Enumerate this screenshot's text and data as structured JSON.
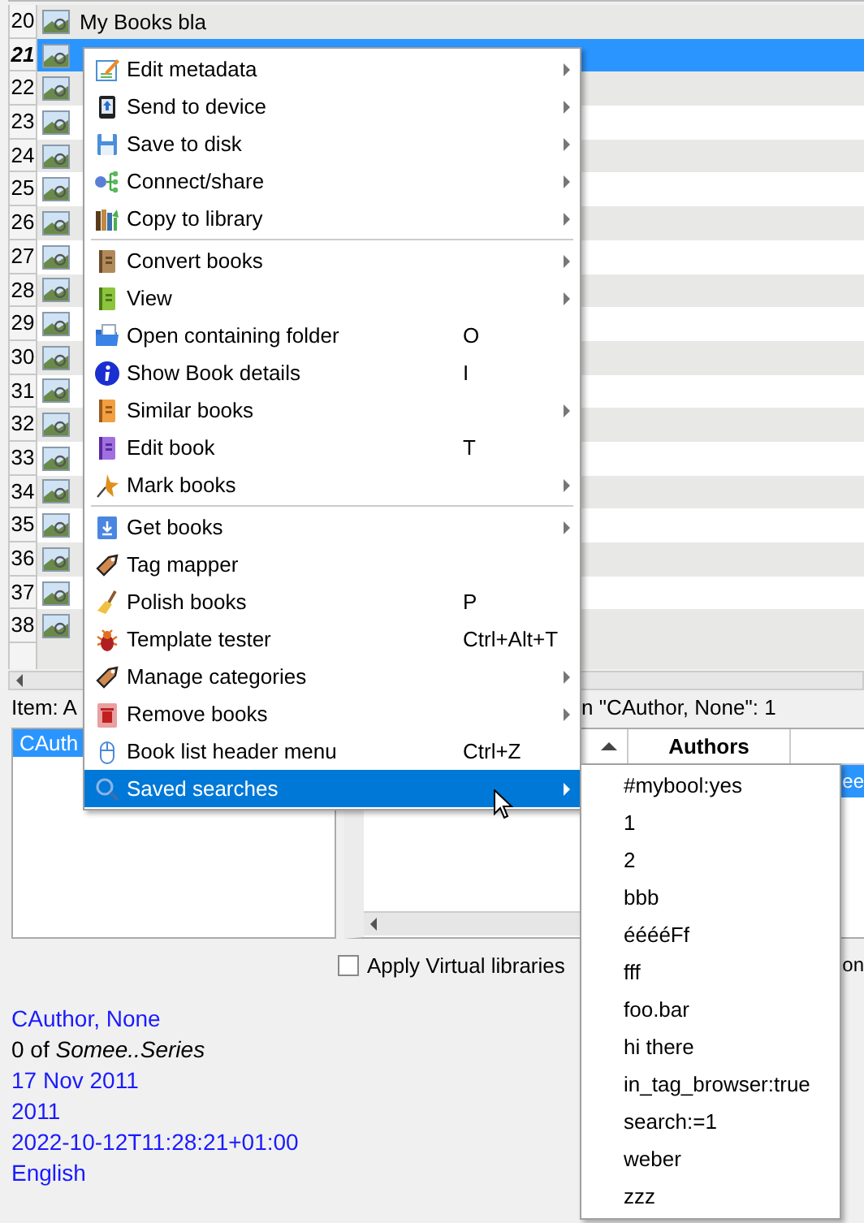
{
  "book_list": {
    "rows": [
      {
        "number": "20",
        "title": "My Books bla",
        "selected": false
      },
      {
        "number": "21",
        "selected": true
      },
      {
        "number": "22",
        "selected": false
      },
      {
        "number": "23",
        "selected": false
      },
      {
        "number": "24",
        "selected": false
      },
      {
        "number": "25",
        "selected": false
      },
      {
        "number": "26",
        "selected": false
      },
      {
        "number": "27",
        "selected": false
      },
      {
        "number": "28",
        "selected": false
      },
      {
        "number": "29",
        "selected": false
      },
      {
        "number": "30",
        "selected": false
      },
      {
        "number": "31",
        "selected": false
      },
      {
        "number": "32",
        "selected": false
      },
      {
        "number": "33",
        "selected": false
      },
      {
        "number": "34",
        "selected": false
      },
      {
        "number": "35",
        "selected": false
      },
      {
        "number": "36",
        "selected": false
      },
      {
        "number": "37",
        "selected": false
      },
      {
        "number": "38",
        "selected": false
      }
    ]
  },
  "status": {
    "left": "Item: A",
    "right": "n \"CAuthor, None\": 1"
  },
  "items_list": {
    "items": [
      {
        "label": "CAuth",
        "selected": true
      }
    ]
  },
  "books_table": {
    "sorted_ascending": true,
    "header": "Authors",
    "rows": [
      {
        "text": "ee",
        "selected": true
      }
    ]
  },
  "apply_virtual_libraries": {
    "label": "Apply Virtual libraries",
    "checked": false
  },
  "right_edge_text": "on",
  "details": [
    {
      "text": "CAuthor, None",
      "kind": "link"
    },
    {
      "text": "0 of *Somee..Series*",
      "kind": "series"
    },
    {
      "text": "17 Nov 2011",
      "kind": "link"
    },
    {
      "text": "2011",
      "kind": "link"
    },
    {
      "text": "2022-10-12T11:28:21+01:00",
      "kind": "link"
    },
    {
      "text": "English",
      "kind": "link"
    }
  ],
  "context_menu": {
    "items": [
      {
        "label": "Edit metadata",
        "submenu": true,
        "selected": false,
        "separator_before": false
      },
      {
        "label": "Send to device",
        "submenu": true,
        "selected": false,
        "separator_before": false
      },
      {
        "label": "Save to disk",
        "submenu": true,
        "selected": false,
        "separator_before": false
      },
      {
        "label": "Connect/share",
        "submenu": true,
        "selected": false,
        "separator_before": false
      },
      {
        "label": "Copy to library",
        "submenu": true,
        "selected": false,
        "separator_before": false
      },
      {
        "label": "Convert books",
        "submenu": true,
        "selected": false,
        "separator_before": true
      },
      {
        "label": "View",
        "submenu": true,
        "selected": false,
        "separator_before": false
      },
      {
        "label": "Open containing folder",
        "shortcut": "O",
        "submenu": false,
        "selected": false,
        "separator_before": false
      },
      {
        "label": "Show Book details",
        "shortcut": "I",
        "submenu": false,
        "selected": false,
        "separator_before": false
      },
      {
        "label": "Similar books",
        "submenu": true,
        "selected": false,
        "separator_before": false
      },
      {
        "label": "Edit book",
        "shortcut": "T",
        "submenu": false,
        "selected": false,
        "separator_before": false
      },
      {
        "label": "Mark books",
        "submenu": true,
        "selected": false,
        "separator_before": false
      },
      {
        "label": "Get books",
        "submenu": true,
        "selected": false,
        "separator_before": true
      },
      {
        "label": "Tag mapper",
        "submenu": false,
        "selected": false,
        "separator_before": false
      },
      {
        "label": "Polish books",
        "shortcut": "P",
        "submenu": false,
        "selected": false,
        "separator_before": false
      },
      {
        "label": "Template tester",
        "shortcut": "Ctrl+Alt+T",
        "submenu": false,
        "selected": false,
        "separator_before": false
      },
      {
        "label": "Manage categories",
        "submenu": true,
        "selected": false,
        "separator_before": false
      },
      {
        "label": "Remove books",
        "submenu": true,
        "selected": false,
        "separator_before": false
      },
      {
        "label": "Book list header menu",
        "shortcut": "Ctrl+Z",
        "submenu": false,
        "selected": false,
        "separator_before": false
      },
      {
        "label": "Saved searches",
        "submenu": true,
        "selected": true,
        "separator_before": false
      }
    ]
  },
  "saved_searches_menu": {
    "items": [
      "#mybool:yes",
      "1",
      "2",
      "bbb",
      "ééééFf",
      "fff",
      "foo.bar",
      "hi there",
      "in_tag_browser:true",
      "search:=1",
      "weber",
      "zzz"
    ]
  }
}
